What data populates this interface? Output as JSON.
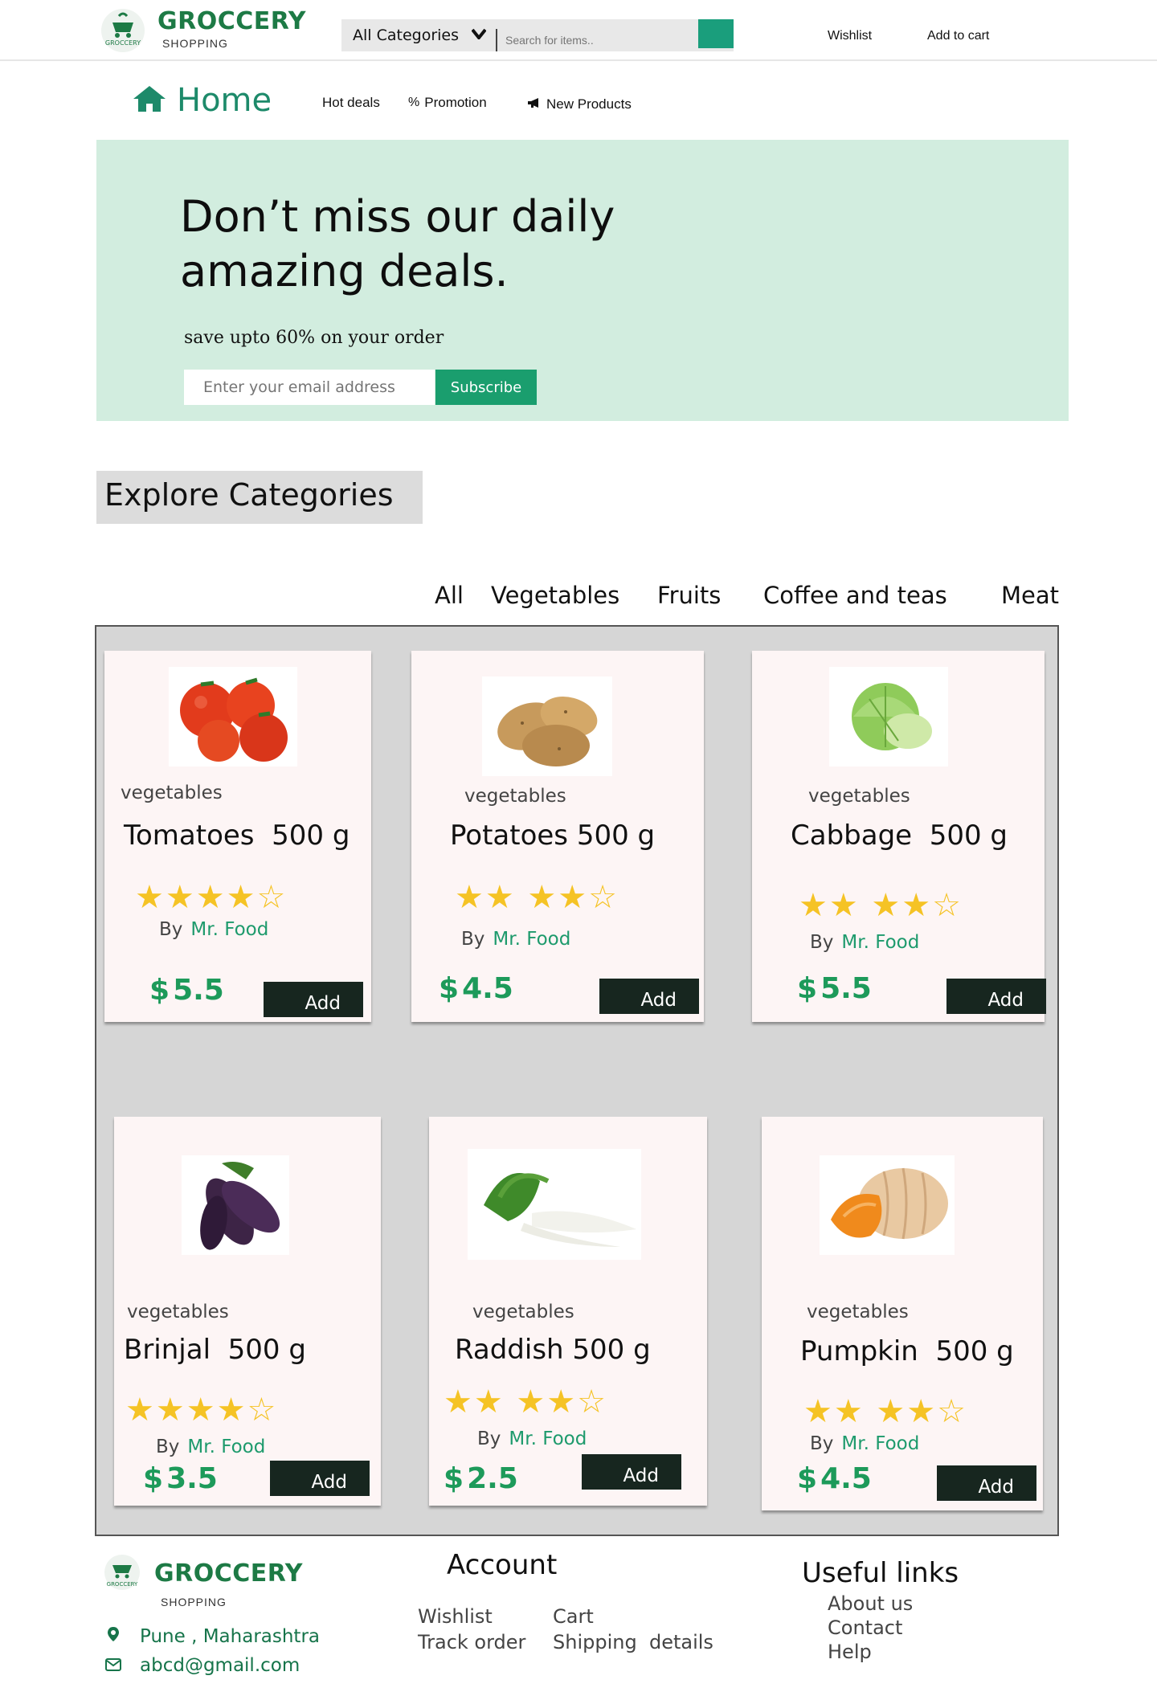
{
  "brand": {
    "name": "GROCCERY",
    "tagline": "SHOPPING",
    "badge_text": "GROCCERY",
    "color": "#1d7a45"
  },
  "header": {
    "category_select": "All Categories",
    "search_placeholder": "Search for items..",
    "search_icon": "search-icon",
    "wishlist": "Wishlist",
    "add_to_cart": "Add to cart"
  },
  "nav": {
    "home": "Home",
    "hot_deals": "Hot deals",
    "promotion_icon": "%",
    "promotion": "Promotion",
    "new_products_icon": "megaphone-icon",
    "new_products": "New Products"
  },
  "hero": {
    "title": "Don’t miss our daily amazing deals.",
    "subtitle": "save upto 60%  on your order",
    "email_placeholder": "Enter your email address",
    "subscribe": "Subscribe",
    "background": "#d2eddf",
    "accent": "#1a9e6e"
  },
  "explore": {
    "title": "Explore Categories",
    "filters": [
      "All",
      "Vegetables",
      "Fruits",
      "Coffee and teas",
      "Meat"
    ]
  },
  "products": [
    {
      "category": "vegetables",
      "name": "Tomatoes  500 g",
      "rating": 4,
      "stars_full": "★★★★",
      "stars_empty": "☆",
      "by": "By",
      "vendor": "Mr. Food",
      "currency": "$",
      "price": "5.5",
      "add": "Add",
      "image": "tomatoes-image"
    },
    {
      "category": "vegetables",
      "name": "Potatoes 500 g",
      "rating": 4,
      "stars_full": "★★ ★★",
      "stars_empty": "☆",
      "by": "By",
      "vendor": "Mr. Food",
      "currency": "$",
      "price": "4.5",
      "add": "Add",
      "image": "potatoes-image"
    },
    {
      "category": "vegetables",
      "name": "Cabbage  500 g",
      "rating": 4,
      "stars_full": "★★ ★★",
      "stars_empty": "☆",
      "by": "By",
      "vendor": "Mr. Food",
      "currency": "$",
      "price": "5.5",
      "add": "Add",
      "image": "cabbage-image"
    },
    {
      "category": "vegetables",
      "name": "Brinjal  500 g",
      "rating": 4,
      "stars_full": "★★★★",
      "stars_empty": "☆",
      "by": "By",
      "vendor": "Mr. Food",
      "currency": "$",
      "price": "3.5",
      "add": "Add",
      "image": "brinjal-image"
    },
    {
      "category": "vegetables",
      "name": "Raddish 500 g",
      "rating": 4,
      "stars_full": "★★ ★★",
      "stars_empty": "☆",
      "by": "By",
      "vendor": "Mr. Food",
      "currency": "$",
      "price": "2.5",
      "add": "Add",
      "image": "raddish-image"
    },
    {
      "category": "vegetables",
      "name": "Pumpkin  500 g",
      "rating": 4,
      "stars_full": "★★ ★★",
      "stars_empty": "☆",
      "by": "By",
      "vendor": "Mr. Food",
      "currency": "$",
      "price": "4.5",
      "add": "Add",
      "image": "pumpkin-image"
    }
  ],
  "footer": {
    "location_icon": "map-pin-icon",
    "location": "Pune , Maharashtra",
    "email_icon": "mail-icon",
    "email": "abcd@gmail.com",
    "account_title": "Account",
    "account_links": [
      "Wishlist",
      "Cart",
      "Track order",
      "Shipping  details"
    ],
    "useful_title": "Useful links",
    "useful_links": [
      "About us",
      "Contact",
      "Help"
    ]
  }
}
